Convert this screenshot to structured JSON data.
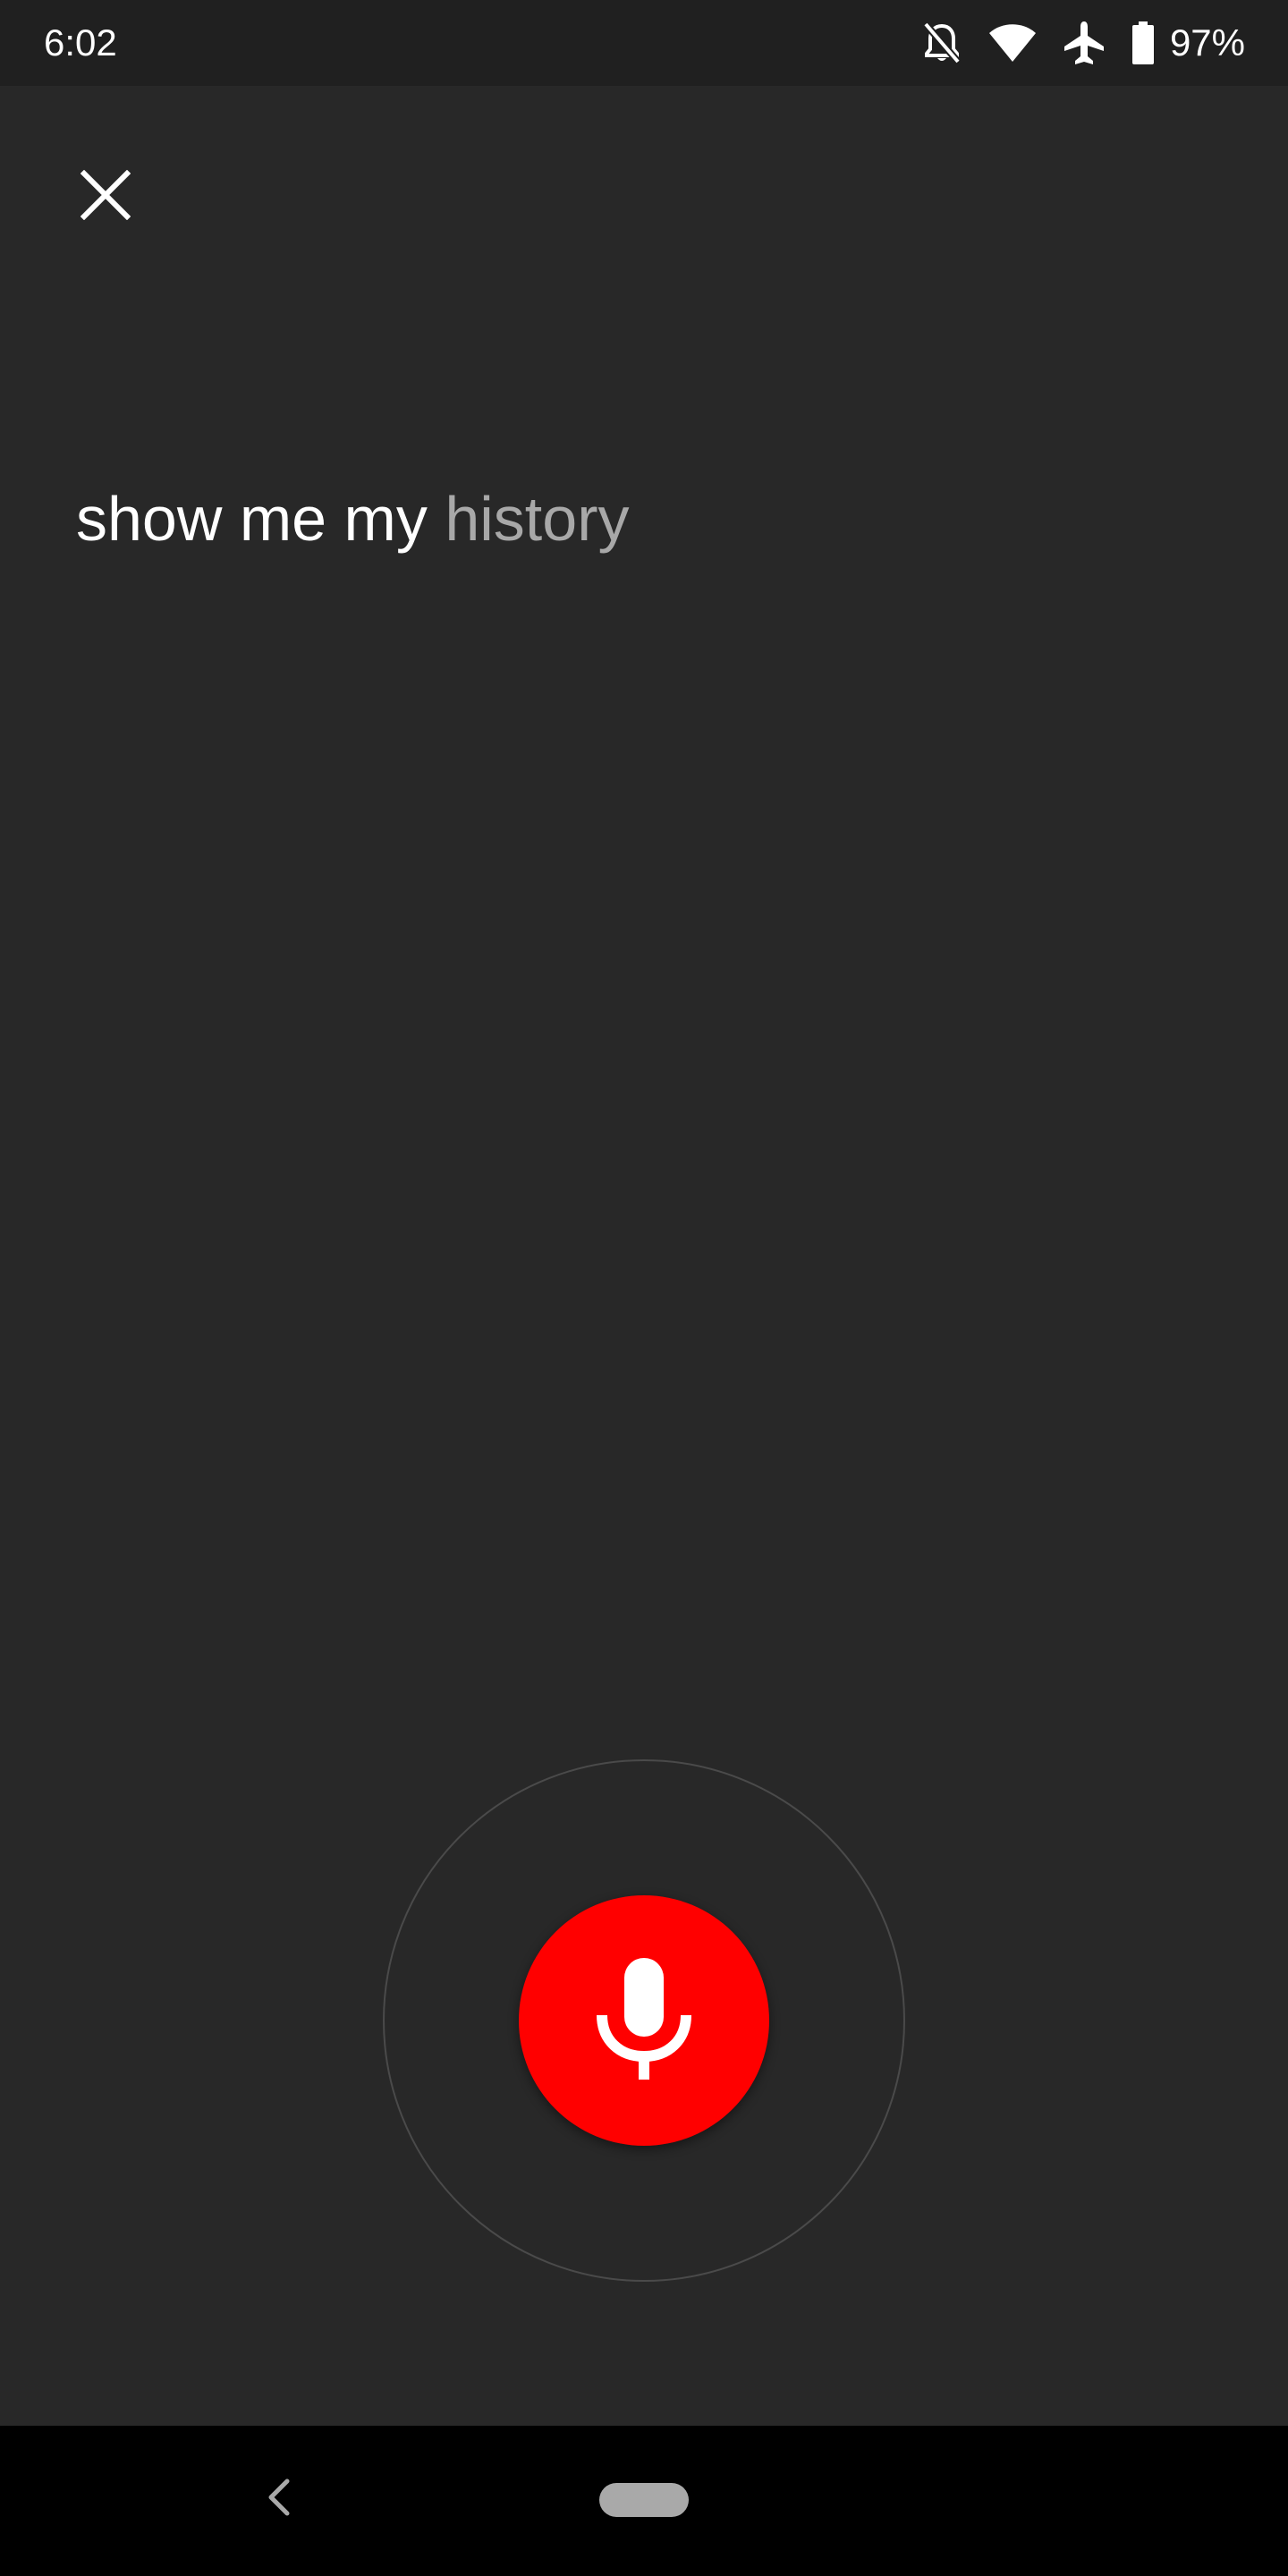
{
  "status_bar": {
    "time": "6:02",
    "icons": [
      "notifications-off-icon",
      "wifi-icon",
      "airplane-mode-icon",
      "battery-icon"
    ],
    "battery_percent": "97%"
  },
  "voice_search": {
    "close_icon": "close-icon",
    "query_final": "show me my",
    "query_partial": "history",
    "mic_icon": "microphone-icon",
    "mic_color": "#ff0000"
  },
  "navigation_bar": {
    "back_icon": "back-icon",
    "home_icon": "home-pill-icon"
  },
  "colors": {
    "background": "#282828",
    "status_bar": "#202020",
    "nav_bar": "#000000",
    "text_primary": "#ffffff",
    "text_partial": "#a8a8a8"
  }
}
